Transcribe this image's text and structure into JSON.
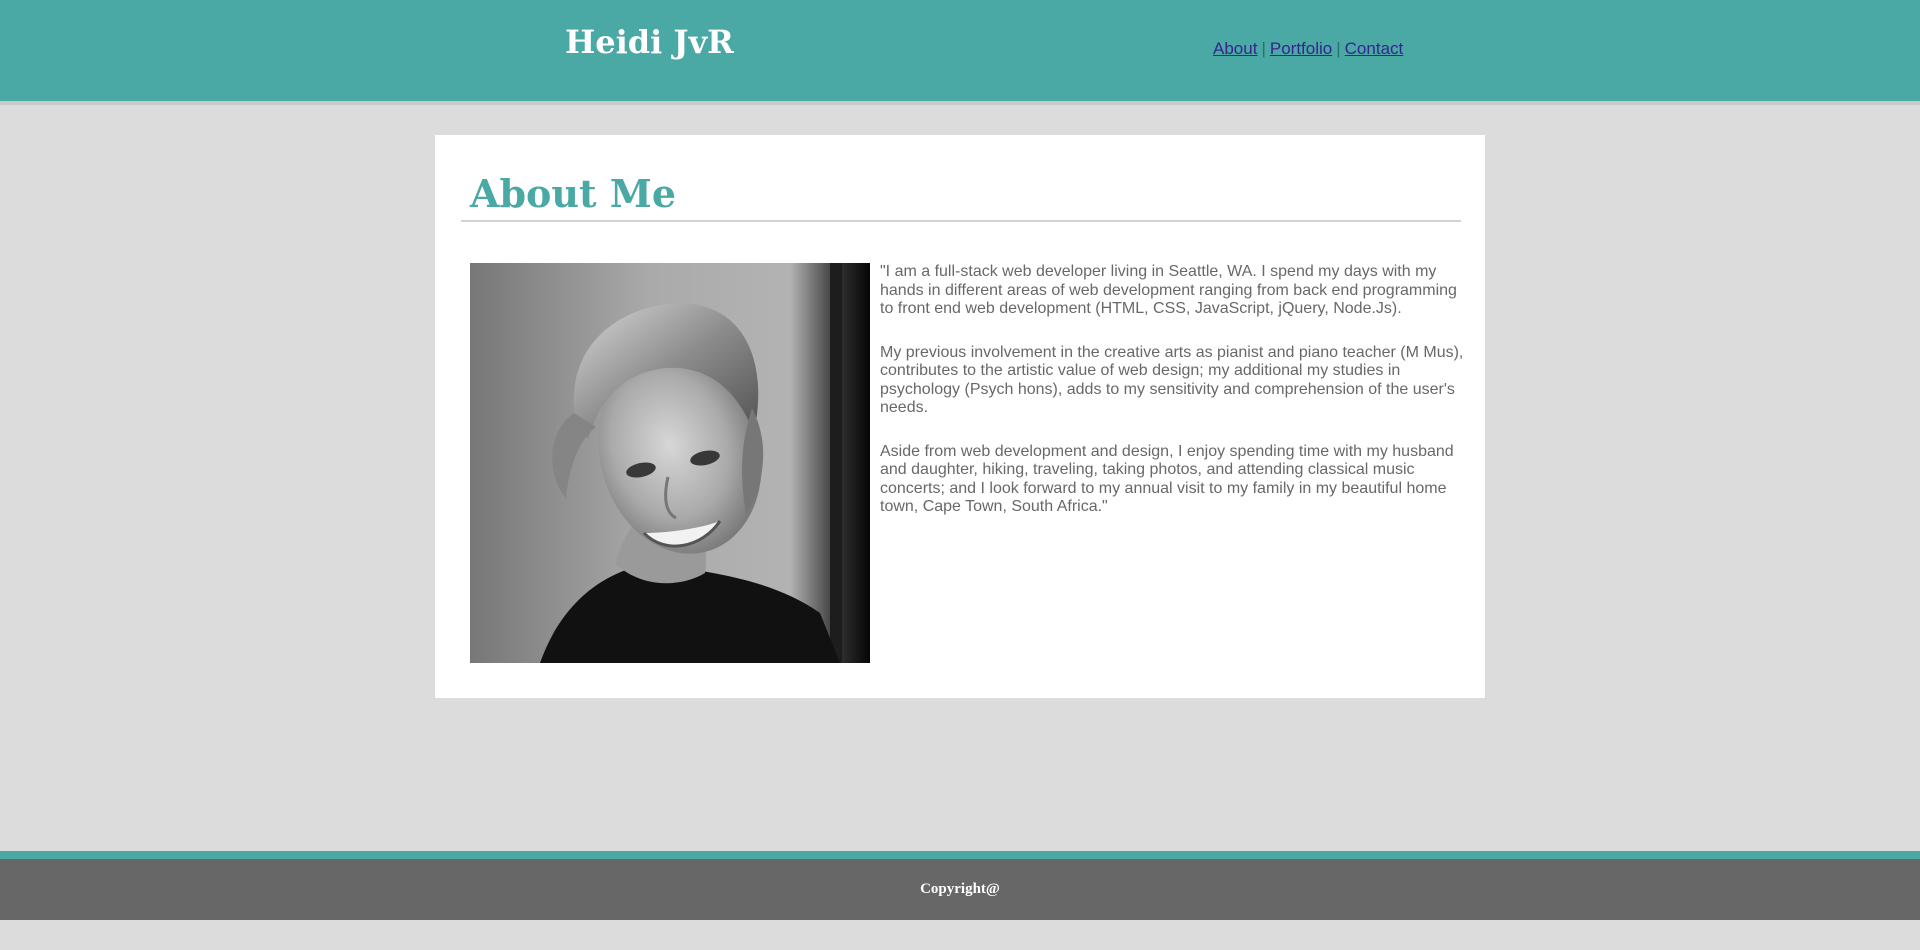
{
  "header": {
    "site_title": "Heidi JvR",
    "nav": [
      {
        "label": "About"
      },
      {
        "label": "Portfolio"
      },
      {
        "label": "Contact"
      }
    ],
    "separator": "|"
  },
  "main": {
    "title": "About Me",
    "portrait_icon": "portrait-photo",
    "bio": [
      "\"I am a full-stack web developer living in Seattle, WA. I spend my days with my hands in different areas of web development ranging from back end programming to front end web development (HTML, CSS, JavaScript, jQuery, Node.Js).",
      "My previous involvement in the creative arts as pianist and piano teacher (M Mus), contributes to the artistic value of web design; my additional my studies in psychology (Psych hons), adds to my sensitivity and comprehension of the user's needs.",
      "Aside from web development and design, I enjoy spending time with my husband and daughter, hiking, traveling, taking photos, and attending classical music concerts; and I look forward to my annual visit to my family in my beautiful home town, Cape Town, South Africa.\""
    ]
  },
  "footer": {
    "copyright": "Copyright@"
  },
  "colors": {
    "brand_teal": "#4aa9a5",
    "page_background": "#dcdcdc",
    "footer_gray": "#676767",
    "link": "#38238f"
  }
}
